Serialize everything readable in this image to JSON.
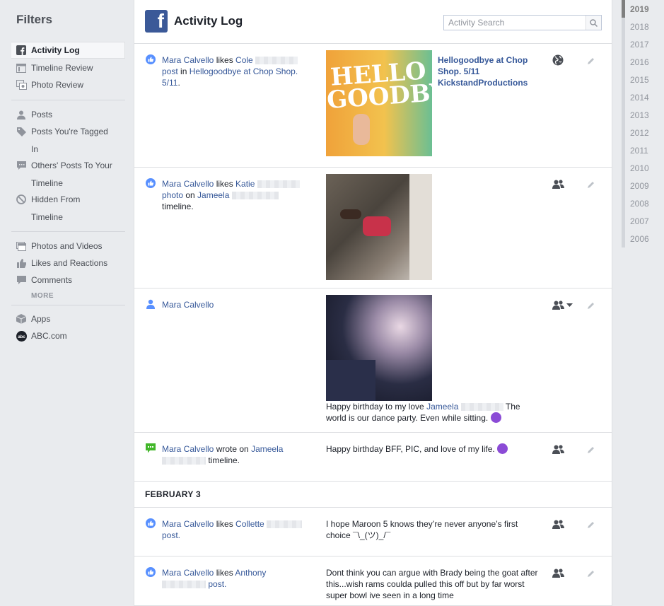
{
  "sidebar": {
    "title": "Filters",
    "items": [
      {
        "label": "Activity Log",
        "icon": "facebook-icon"
      },
      {
        "label": "Timeline Review",
        "icon": "timeline-icon"
      },
      {
        "label": "Photo Review",
        "icon": "photo-review-icon"
      },
      {
        "label": "Posts",
        "icon": "person-icon"
      },
      {
        "label": "Posts You're Tagged",
        "cont": "In",
        "icon": "tag-icon"
      },
      {
        "label": "Others' Posts To Your",
        "cont": "Timeline",
        "icon": "speech-bubble-icon"
      },
      {
        "label": "Hidden From",
        "cont": "Timeline",
        "icon": "hidden-icon"
      },
      {
        "label": "Photos and Videos",
        "icon": "photos-icon"
      },
      {
        "label": "Likes and Reactions",
        "icon": "thumbs-up-icon"
      },
      {
        "label": "Comments",
        "icon": "comment-icon"
      },
      {
        "label": "Apps",
        "icon": "cube-icon"
      },
      {
        "label": "ABC.com",
        "icon": "abc-icon"
      }
    ],
    "more": "MORE"
  },
  "header": {
    "title": "Activity Log",
    "logo": "f",
    "search_placeholder": "Activity Search"
  },
  "rows": [
    {
      "actor": "Mara Calvello",
      "verb": " likes ",
      "target": "Cole",
      "post": "post",
      "in": " in ",
      "place": "Hellogoodbye at Chop Shop. 5/11",
      "end": ".",
      "content_title": "Hellogoodbye at Chop Shop. 5/11 KickstandProductions",
      "thumb_text": "HELLO GOODBYE",
      "privacy": "globe-icon"
    },
    {
      "actor": "Mara Calvello",
      "verb": " likes ",
      "target": "Katie",
      "post": "photo",
      "on": " on ",
      "owner": "Jameela",
      "end": "timeline.",
      "privacy": "friends-icon"
    },
    {
      "actor": "Mara Calvello",
      "caption_a": "Happy birthday to my love ",
      "caption_link": "Jameela",
      "caption_b": " The world is our dance party. Even while sitting. ",
      "privacy": "friends-dropdown-icon"
    },
    {
      "actor": "Mara Calvello",
      "verb": " wrote on ",
      "target": "Jameela",
      "end": " timeline.",
      "content": "Happy birthday BFF, PIC, and love of my life. ",
      "privacy": "friends-icon"
    }
  ],
  "date_header": "FEBRUARY 3",
  "rows2": [
    {
      "actor": "Mara Calvello",
      "verb": " likes ",
      "target": "Collette",
      "post": "post.",
      "content": "I hope Maroon 5 knows they’re never anyone’s first choice ¯\\_(ツ)_/¯",
      "privacy": "friends-icon"
    },
    {
      "actor": "Mara Calvello",
      "verb": " likes ",
      "target": "Anthony",
      "post": "post.",
      "content": "Dont think you can argue with Brady being the goat after this...wish rams coulda pulled this off but by far worst super bowl ive seen in a long time",
      "privacy": "friends-icon"
    }
  ],
  "years": [
    "2019",
    "2018",
    "2017",
    "2016",
    "2015",
    "2014",
    "2013",
    "2012",
    "2011",
    "2010",
    "2009",
    "2008",
    "2007",
    "2006"
  ],
  "colors": {
    "link": "#365899",
    "brand": "#3b5998",
    "like": "#5890ff"
  }
}
